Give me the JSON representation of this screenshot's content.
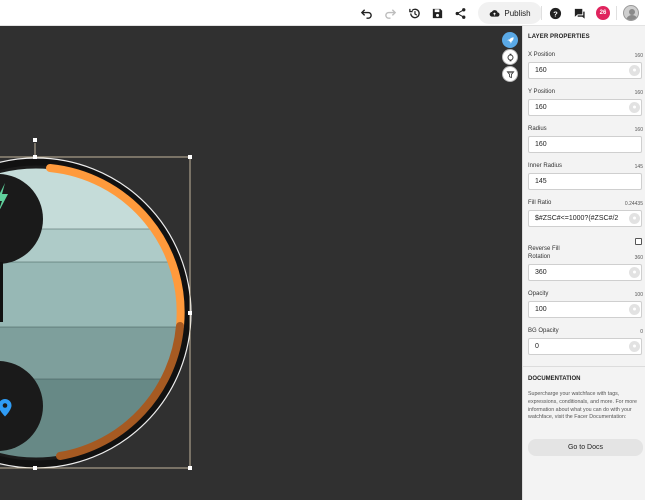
{
  "toolbar": {
    "icons": [
      "undo-icon",
      "redo-icon",
      "history-icon",
      "save-icon",
      "share-icon"
    ],
    "publish_label": "Publish",
    "notification_count": "26",
    "right_icons": [
      "help-icon",
      "comments-icon",
      "notifications-icon"
    ]
  },
  "panel": {
    "title": "LAYER PROPERTIES",
    "fields": [
      {
        "label": "X Position",
        "value": "160",
        "input": "160"
      },
      {
        "label": "Y Position",
        "value": "160",
        "input": "160"
      },
      {
        "label": "Radius",
        "value": "160",
        "input": "160"
      },
      {
        "label": "Inner Radius",
        "value": "145",
        "input": "145"
      },
      {
        "label": "Fill Ratio",
        "value": "0.24435",
        "input": "$#ZSC#<=1000?(#ZSC#/2"
      },
      {
        "label": "Rotation",
        "value": "360",
        "input": "360"
      },
      {
        "label": "Opacity",
        "value": "100",
        "input": "100"
      },
      {
        "label": "BG Opacity",
        "value": "0",
        "input": "0"
      }
    ],
    "reverse_fill_label": "Reverse Fill",
    "reverse_fill_checked": false,
    "documentation": {
      "title": "DOCUMENTATION",
      "text": "Supercharge your watchface with tags, expressions, conditionals, and more. For more information about what you can do with your watchface, visit the Facer Documentation:",
      "button_label": "Go to Docs"
    }
  },
  "canvas": {
    "floating_icons": [
      "rocket-icon",
      "watch-icon",
      "filter-icon"
    ],
    "colors": {
      "background": "#303030",
      "ring": "#ff9a3c",
      "ring_dark": "#a65a22",
      "stripes": [
        "#c5dcd9",
        "#aecbc8",
        "#97b8b5",
        "#7e9f9c",
        "#678986"
      ]
    },
    "complication_icons": [
      "lightning-icon",
      "location-pin-icon"
    ]
  }
}
